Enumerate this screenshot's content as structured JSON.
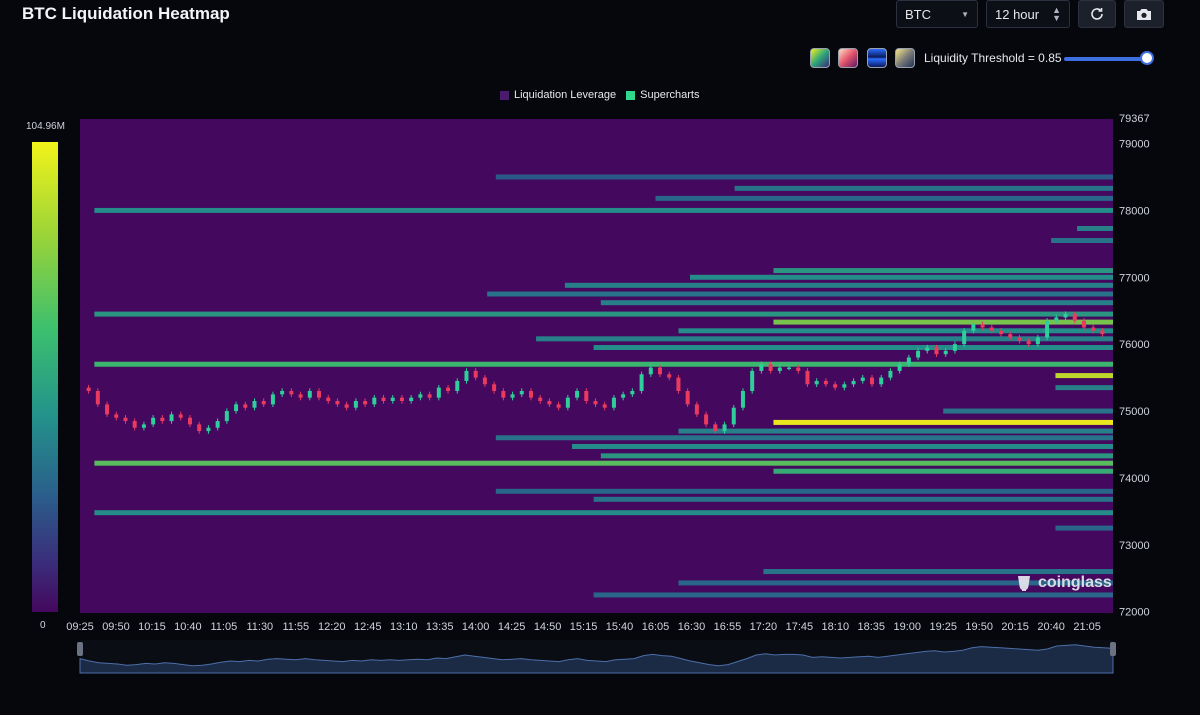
{
  "header": {
    "title": "BTC Liquidation Heatmap",
    "symbol_select": "BTC",
    "range_select": "12 hour",
    "refresh_icon": "refresh-icon",
    "camera_icon": "camera-icon"
  },
  "controls": {
    "color_schemes": [
      "viridis",
      "magma",
      "blue",
      "cividis"
    ],
    "threshold_label": "Liquidity Threshold = 0.85",
    "threshold_value": 0.85
  },
  "legend": [
    {
      "label": "Liquidation Leverage",
      "color": "#4a1a6e"
    },
    {
      "label": "Supercharts",
      "color": "#2fd98b"
    }
  ],
  "colorbar": {
    "max_label": "104.96M",
    "min_label": "0"
  },
  "watermark": "coinglass",
  "chart_data": {
    "type": "heatmap",
    "title": "BTC Liquidation Heatmap",
    "x_tick_labels": [
      "09:25",
      "09:50",
      "10:15",
      "10:40",
      "11:05",
      "11:30",
      "11:55",
      "12:20",
      "12:45",
      "13:10",
      "13:35",
      "14:00",
      "14:25",
      "14:50",
      "15:15",
      "15:40",
      "16:05",
      "16:30",
      "16:55",
      "17:20",
      "17:45",
      "18:10",
      "18:35",
      "19:00",
      "19:25",
      "19:50",
      "20:15",
      "20:40",
      "21:05"
    ],
    "y_ticks": [
      72000,
      73000,
      74000,
      75000,
      76000,
      77000,
      78000,
      79000
    ],
    "y_max_label": "79367",
    "ylim": [
      71980,
      79367
    ],
    "colorbar_range": [
      0,
      104.96
    ],
    "colorbar_unit": "M",
    "background_color": "#44085e",
    "liquidity_bands": [
      {
        "price": 78500,
        "start": "14:14",
        "intensity": 0.35
      },
      {
        "price": 78330,
        "start": "17:00",
        "intensity": 0.45
      },
      {
        "price": 78180,
        "start": "16:05",
        "intensity": 0.4
      },
      {
        "price": 78000,
        "start": "09:35",
        "intensity": 0.55
      },
      {
        "price": 77730,
        "start": "20:58",
        "intensity": 0.5
      },
      {
        "price": 77550,
        "start": "20:40",
        "intensity": 0.45
      },
      {
        "price": 77100,
        "start": "17:27",
        "intensity": 0.6
      },
      {
        "price": 77000,
        "start": "16:29",
        "intensity": 0.55
      },
      {
        "price": 76880,
        "start": "15:02",
        "intensity": 0.5
      },
      {
        "price": 76750,
        "start": "14:08",
        "intensity": 0.45
      },
      {
        "price": 76620,
        "start": "15:27",
        "intensity": 0.5
      },
      {
        "price": 76450,
        "start": "09:35",
        "intensity": 0.6
      },
      {
        "price": 76330,
        "start": "17:27",
        "intensity": 0.85
      },
      {
        "price": 76200,
        "start": "16:21",
        "intensity": 0.55
      },
      {
        "price": 76080,
        "start": "14:42",
        "intensity": 0.5
      },
      {
        "price": 75950,
        "start": "15:22",
        "intensity": 0.55
      },
      {
        "price": 75700,
        "start": "09:35",
        "intensity": 0.75
      },
      {
        "price": 75530,
        "start": "20:43",
        "intensity": 0.95
      },
      {
        "price": 75350,
        "start": "20:43",
        "intensity": 0.5
      },
      {
        "price": 75000,
        "start": "19:25",
        "intensity": 0.45
      },
      {
        "price": 74830,
        "start": "17:27",
        "intensity": 1.0
      },
      {
        "price": 74700,
        "start": "16:21",
        "intensity": 0.5
      },
      {
        "price": 74600,
        "start": "14:14",
        "intensity": 0.45
      },
      {
        "price": 74470,
        "start": "15:07",
        "intensity": 0.55
      },
      {
        "price": 74330,
        "start": "15:27",
        "intensity": 0.6
      },
      {
        "price": 74220,
        "start": "09:35",
        "intensity": 0.8
      },
      {
        "price": 74100,
        "start": "17:27",
        "intensity": 0.7
      },
      {
        "price": 73800,
        "start": "14:14",
        "intensity": 0.4
      },
      {
        "price": 73680,
        "start": "15:22",
        "intensity": 0.45
      },
      {
        "price": 73480,
        "start": "09:35",
        "intensity": 0.55
      },
      {
        "price": 73250,
        "start": "20:43",
        "intensity": 0.4
      },
      {
        "price": 72600,
        "start": "17:20",
        "intensity": 0.45
      },
      {
        "price": 72430,
        "start": "16:21",
        "intensity": 0.4
      },
      {
        "price": 72250,
        "start": "15:22",
        "intensity": 0.4
      }
    ],
    "candles_close": [
      75300,
      75100,
      74950,
      74900,
      74850,
      74750,
      74800,
      74900,
      74850,
      74950,
      74900,
      74800,
      74700,
      74750,
      74850,
      75000,
      75100,
      75050,
      75150,
      75100,
      75250,
      75300,
      75250,
      75200,
      75300,
      75200,
      75150,
      75100,
      75050,
      75150,
      75100,
      75200,
      75150,
      75200,
      75150,
      75200,
      75250,
      75200,
      75350,
      75300,
      75450,
      75600,
      75500,
      75400,
      75300,
      75200,
      75250,
      75300,
      75200,
      75150,
      75100,
      75050,
      75200,
      75300,
      75150,
      75100,
      75050,
      75200,
      75250,
      75300,
      75550,
      75650,
      75550,
      75500,
      75300,
      75100,
      74950,
      74800,
      74700,
      74800,
      75050,
      75300,
      75600,
      75700,
      75600,
      75650,
      75650,
      75600,
      75400,
      75450,
      75400,
      75350,
      75400,
      75450,
      75500,
      75400,
      75500,
      75600,
      75700,
      75800,
      75900,
      75950,
      75850,
      75900,
      76000,
      76200,
      76300,
      76250,
      76200,
      76150,
      76100,
      76050,
      76000,
      76100,
      76350,
      76400,
      76450,
      76350,
      76250,
      76200,
      76150
    ]
  }
}
